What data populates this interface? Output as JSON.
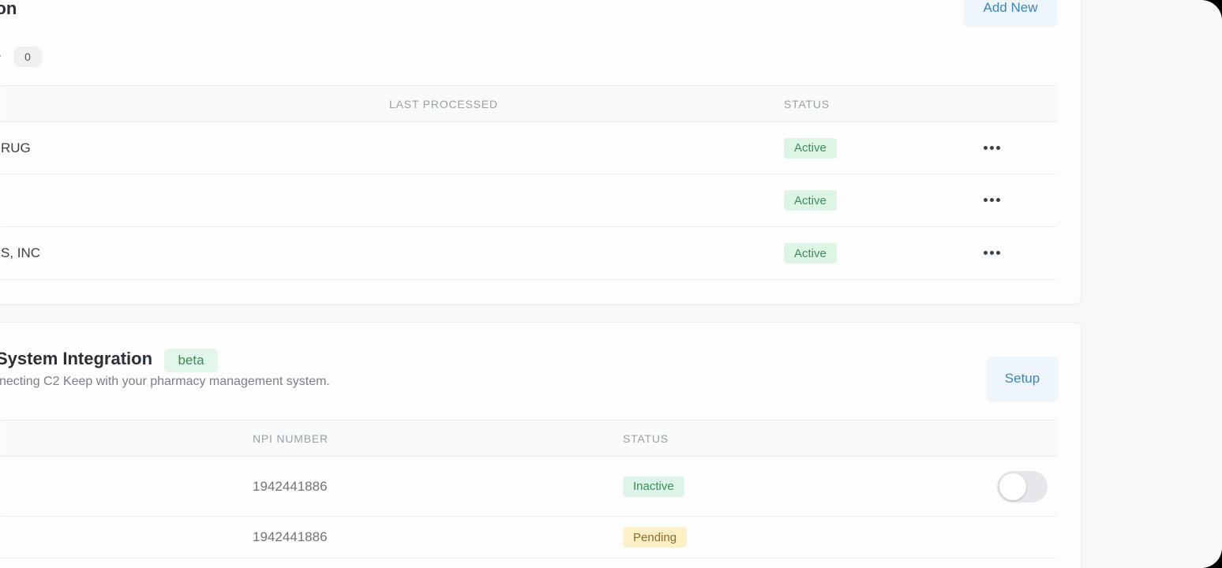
{
  "app": {
    "brand_colors": {
      "accent": "#3d86b8",
      "success_bg": "#dcf5e4",
      "pending_bg": "#fbf0c6"
    }
  },
  "section1": {
    "title": "tion",
    "add_button_label": "Add New",
    "count_label": "e",
    "count_value": "0",
    "columns": [
      "LAST PROCESSED",
      "STATUS"
    ],
    "rows": [
      {
        "name": "RUG",
        "last_processed": "",
        "status": "Active",
        "more_icon": "more-horizontal-icon"
      },
      {
        "name": "",
        "last_processed": "",
        "status": "Active",
        "more_icon": "more-horizontal-icon"
      },
      {
        "name": "S, INC",
        "last_processed": "",
        "status": "Active",
        "more_icon": "more-horizontal-icon"
      }
    ]
  },
  "section2": {
    "title": "System Integration",
    "badge": "beta",
    "subtitle": "necting C2 Keep with your pharmacy management system.",
    "setup_button_label": "Setup",
    "columns": [
      "NPI NUMBER",
      "STATUS"
    ],
    "rows": [
      {
        "npi": "1942441886",
        "status": "Inactive",
        "toggle_on": false
      },
      {
        "npi": "1942441886",
        "status": "Pending"
      }
    ]
  }
}
